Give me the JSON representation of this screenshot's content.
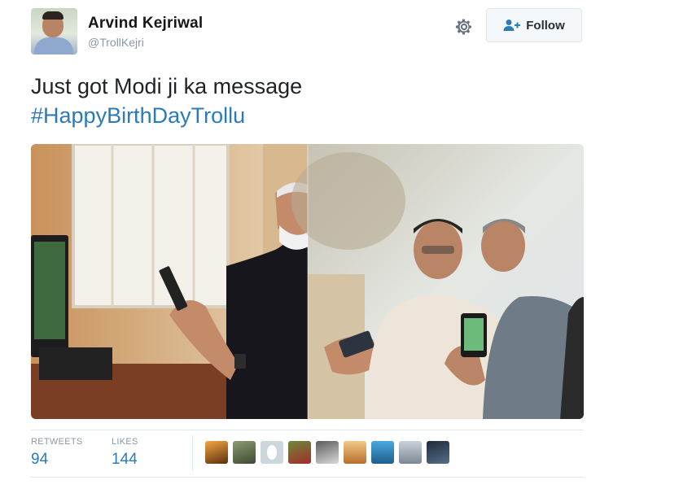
{
  "tweet": {
    "author_name": "Arvind Kejriwal",
    "author_handle": "@TrollKejri",
    "text_line": "Just got Modi ji ka message",
    "hashtag": "#HappyBirthDayTrollu",
    "follow_label": "Follow",
    "icons": {
      "settings": "gear-icon",
      "follow": "add-user-icon"
    }
  },
  "stats": {
    "retweets_label": "RETWEETS",
    "retweets_count": "94",
    "likes_label": "LIKES",
    "likes_count": "144"
  },
  "likers_count": 9,
  "colors": {
    "link": "#2b7bb9",
    "muted": "#8899a6",
    "border": "#e1e8ed"
  }
}
